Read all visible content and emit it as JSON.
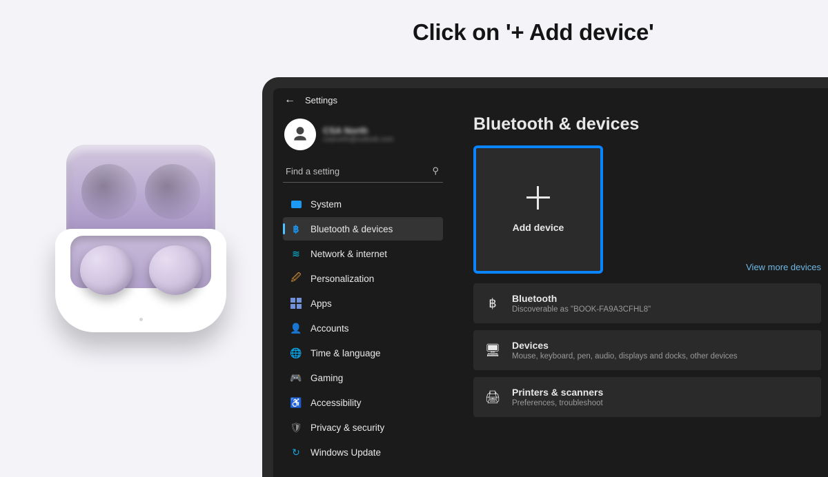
{
  "caption": "Click on '+ Add device'",
  "window": {
    "app_name": "Settings"
  },
  "user": {
    "display_name": "CSA North",
    "email": "csanorth@outlook.com"
  },
  "search": {
    "placeholder": "Find a setting"
  },
  "sidebar": {
    "items": [
      {
        "label": "System"
      },
      {
        "label": "Bluetooth & devices"
      },
      {
        "label": "Network & internet"
      },
      {
        "label": "Personalization"
      },
      {
        "label": "Apps"
      },
      {
        "label": "Accounts"
      },
      {
        "label": "Time & language"
      },
      {
        "label": "Gaming"
      },
      {
        "label": "Accessibility"
      },
      {
        "label": "Privacy & security"
      },
      {
        "label": "Windows Update"
      }
    ],
    "active_index": 1
  },
  "main": {
    "heading": "Bluetooth & devices",
    "add_device_label": "Add device",
    "view_more_label": "View more devices",
    "rows": [
      {
        "title": "Bluetooth",
        "subtitle": "Discoverable as \"BOOK-FA9A3CFHL8\""
      },
      {
        "title": "Devices",
        "subtitle": "Mouse, keyboard, pen, audio, displays and docks, other devices"
      },
      {
        "title": "Printers & scanners",
        "subtitle": "Preferences, troubleshoot"
      }
    ]
  },
  "colors": {
    "highlight": "#0a84ff",
    "accent_link": "#6fb9e6"
  }
}
